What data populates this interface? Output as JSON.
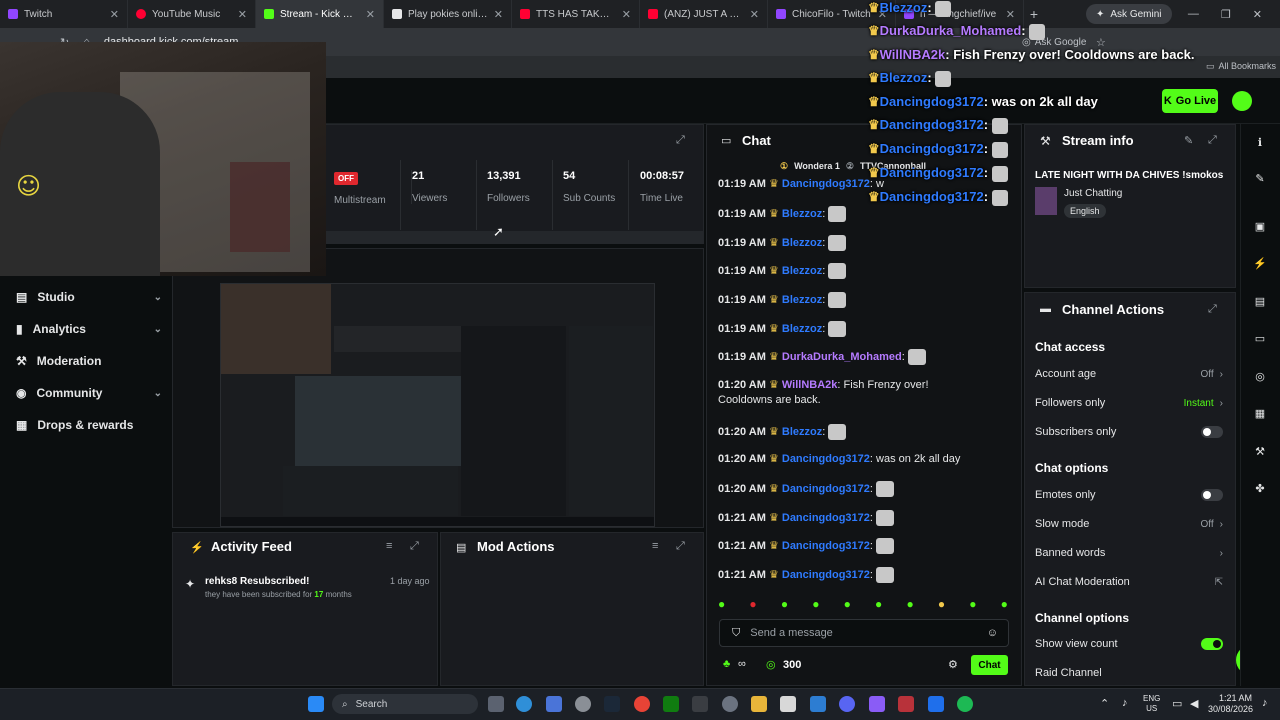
{
  "browser": {
    "tabs": [
      {
        "label": "Twitch",
        "color": "#9146ff"
      },
      {
        "label": "YouTube Music",
        "color": "#ff0033"
      },
      {
        "label": "Stream - Kick Dashboa",
        "color": "#53fc18"
      },
      {
        "label": "Play pokies online - Sa",
        "color": "#e6e7e8"
      },
      {
        "label": "TTS HAS TAKEN CONT",
        "color": "#ff0033"
      },
      {
        "label": "(ANZ) JUST A CHILL",
        "color": "#ff0033"
      },
      {
        "label": "ChicoFilo - Twitch",
        "color": "#9146ff"
      },
      {
        "label": "n — kingchief/ive",
        "color": "#9146ff"
      }
    ],
    "ask_gemini": "Ask Gemini",
    "url": "dashboard.kick.com/stream",
    "ask_google": "Ask Google",
    "all_bookmarks": "All Bookmarks"
  },
  "header": {
    "go_live": "Go Live"
  },
  "sidebar": {
    "items": [
      {
        "label": "Studio",
        "icon": "studio-icon",
        "chev": "⌄"
      },
      {
        "label": "Analytics",
        "icon": "analytics-icon",
        "chev": "⌄"
      },
      {
        "label": "Moderation",
        "icon": "moderation-icon",
        "chev": ""
      },
      {
        "label": "Community",
        "icon": "community-icon",
        "chev": "⌄"
      },
      {
        "label": "Drops & rewards",
        "icon": "drops-icon",
        "chev": ""
      }
    ]
  },
  "stats": {
    "multistream_status": "OFF",
    "multistream_label": "Multistream",
    "viewers_value": "21",
    "viewers_label": "Viewers",
    "followers_value": "13,391",
    "followers_label": "Followers",
    "subs_value": "54",
    "subs_label": "Sub Counts",
    "time_value": "00:08:57",
    "time_label": "Time Live"
  },
  "activity": {
    "title": "Activity Feed",
    "event_title": "rehks8 Resubscribed!",
    "event_time": "1 day ago",
    "event_desc_prefix": "they have been subscribed for",
    "event_months": "17",
    "event_desc_suffix": "months"
  },
  "mod_actions": {
    "title": "Mod Actions"
  },
  "chat": {
    "title": "Chat",
    "pinned_a": "Wondera 1",
    "pinned_b": "TTVCannonball",
    "messages": [
      {
        "time": "01:19 AM",
        "user": "Dancingdog3172",
        "color": "#2f7bff",
        "text": "w"
      },
      {
        "time": "01:19 AM",
        "user": "Blezzoz",
        "color": "#2f7bff",
        "text": ""
      },
      {
        "time": "01:19 AM",
        "user": "Blezzoz",
        "color": "#2f7bff",
        "text": ""
      },
      {
        "time": "01:19 AM",
        "user": "Blezzoz",
        "color": "#2f7bff",
        "text": ""
      },
      {
        "time": "01:19 AM",
        "user": "Blezzoz",
        "color": "#2f7bff",
        "text": ""
      },
      {
        "time": "01:19 AM",
        "user": "Blezzoz",
        "color": "#2f7bff",
        "text": ""
      },
      {
        "time": "01:19 AM",
        "user": "DurkaDurka_Mohamed",
        "color": "#b57bff",
        "text": ""
      },
      {
        "time": "01:20 AM",
        "user": "WillNBA2k",
        "color": "#b57bff",
        "text": "Fish Frenzy over!",
        "text2": "Cooldowns are back."
      },
      {
        "time": "01:20 AM",
        "user": "Blezzoz",
        "color": "#2f7bff",
        "text": ""
      },
      {
        "time": "01:20 AM",
        "user": "Dancingdog3172",
        "color": "#2f7bff",
        "text": "was on 2k all day"
      },
      {
        "time": "01:20 AM",
        "user": "Dancingdog3172",
        "color": "#2f7bff",
        "text": ""
      },
      {
        "time": "01:21 AM",
        "user": "Dancingdog3172",
        "color": "#2f7bff",
        "text": ""
      },
      {
        "time": "01:21 AM",
        "user": "Dancingdog3172",
        "color": "#2f7bff",
        "text": ""
      },
      {
        "time": "01:21 AM",
        "user": "Dancingdog3172",
        "color": "#2f7bff",
        "text": ""
      }
    ],
    "input_placeholder": "Send a message",
    "points": "300",
    "send_label": "Chat"
  },
  "overlay_chat": [
    {
      "user": "Blezzoz",
      "color": "#2f7bff",
      "text": ""
    },
    {
      "user": "DurkaDurka_Mohamed",
      "color": "#b57bff",
      "text": ""
    },
    {
      "user": "WillNBA2k",
      "color": "#b57bff",
      "text": "Fish Frenzy over! Cooldowns are back."
    },
    {
      "user": "Blezzoz",
      "color": "#2f7bff",
      "text": ""
    },
    {
      "user": "Dancingdog3172",
      "color": "#2f7bff",
      "text": "was on 2k all day"
    },
    {
      "user": "Dancingdog3172",
      "color": "#2f7bff",
      "text": ""
    },
    {
      "user": "Dancingdog3172",
      "color": "#2f7bff",
      "text": ""
    },
    {
      "user": "Dancingdog3172",
      "color": "#2f7bff",
      "text": ""
    },
    {
      "user": "Dancingdog3172",
      "color": "#2f7bff",
      "text": ""
    }
  ],
  "stream_info": {
    "title": "Stream info",
    "stream_title": "LATE NIGHT WITH DA CHIVES !smokos",
    "category": "Just Chatting",
    "language": "English"
  },
  "channel_actions": {
    "title": "Channel Actions",
    "chat_access": "Chat access",
    "account_age": "Account age",
    "account_age_value": "Off",
    "followers_only": "Followers only",
    "followers_only_value": "Instant",
    "subscribers_only": "Subscribers only",
    "chat_options": "Chat options",
    "emotes_only": "Emotes only",
    "slow_mode": "Slow mode",
    "slow_mode_value": "Off",
    "banned_words": "Banned words",
    "ai_chat_moderation": "AI Chat Moderation",
    "channel_options": "Channel options",
    "show_view_count": "Show view count",
    "raid_channel": "Raid Channel"
  },
  "taskbar": {
    "search": "Search",
    "lang": "ENG",
    "region": "US",
    "time": "1:21 AM",
    "date": "30/08/2026"
  },
  "colors": {
    "accent": "#53fc18",
    "offline": "#e0282e",
    "crown": "#f2c94c"
  }
}
